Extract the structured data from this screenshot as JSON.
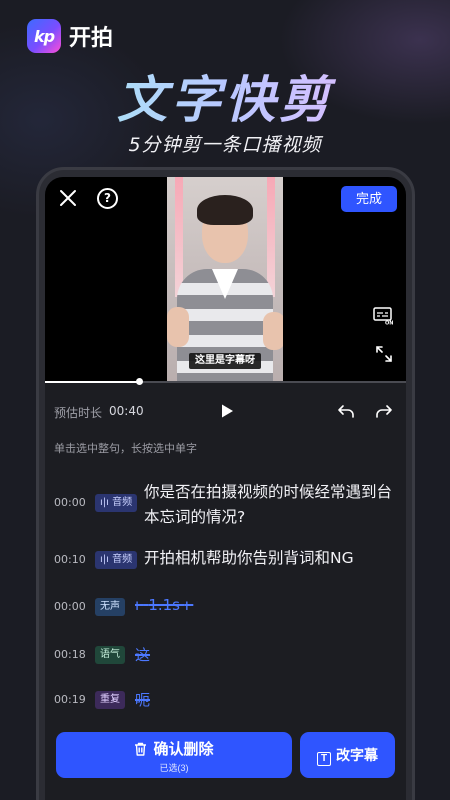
{
  "brand": {
    "logo_text": "kp",
    "name": "开拍"
  },
  "hero": {
    "title": "文字快剪",
    "subtitle": "5分钟剪一条口播视频"
  },
  "editor": {
    "done_label": "完成",
    "help_label": "?",
    "caption_text": "这里是字幕呀",
    "progress": 0.26,
    "estimate_label": "预估时长",
    "estimate_value": "00:40",
    "hint": "单击选中整句，长按选中单字"
  },
  "transcript": [
    {
      "time": "00:00",
      "tag": "音频",
      "tag_type": "audio",
      "text": "你是否在拍摄视频的时候经常遇到台本忘词的情况?",
      "struck": false
    },
    {
      "time": "00:10",
      "tag": "音频",
      "tag_type": "audio",
      "text": "开拍相机帮助你告别背词和NG",
      "struck": false
    },
    {
      "time": "00:00",
      "tag": "无声",
      "tag_type": "silent",
      "text": "1.1s",
      "struck": true
    },
    {
      "time": "00:18",
      "tag": "语气",
      "tag_type": "tone",
      "text": "这",
      "struck": true
    },
    {
      "time": "00:19",
      "tag": "重复",
      "tag_type": "repeat",
      "text": "呃",
      "struck": true
    }
  ],
  "actions": {
    "confirm_label": "确认删除",
    "confirm_sub": "已选(3)",
    "edit_label": "改字幕"
  },
  "colors": {
    "accent": "#2f55ff",
    "strike": "#4c78ff"
  }
}
